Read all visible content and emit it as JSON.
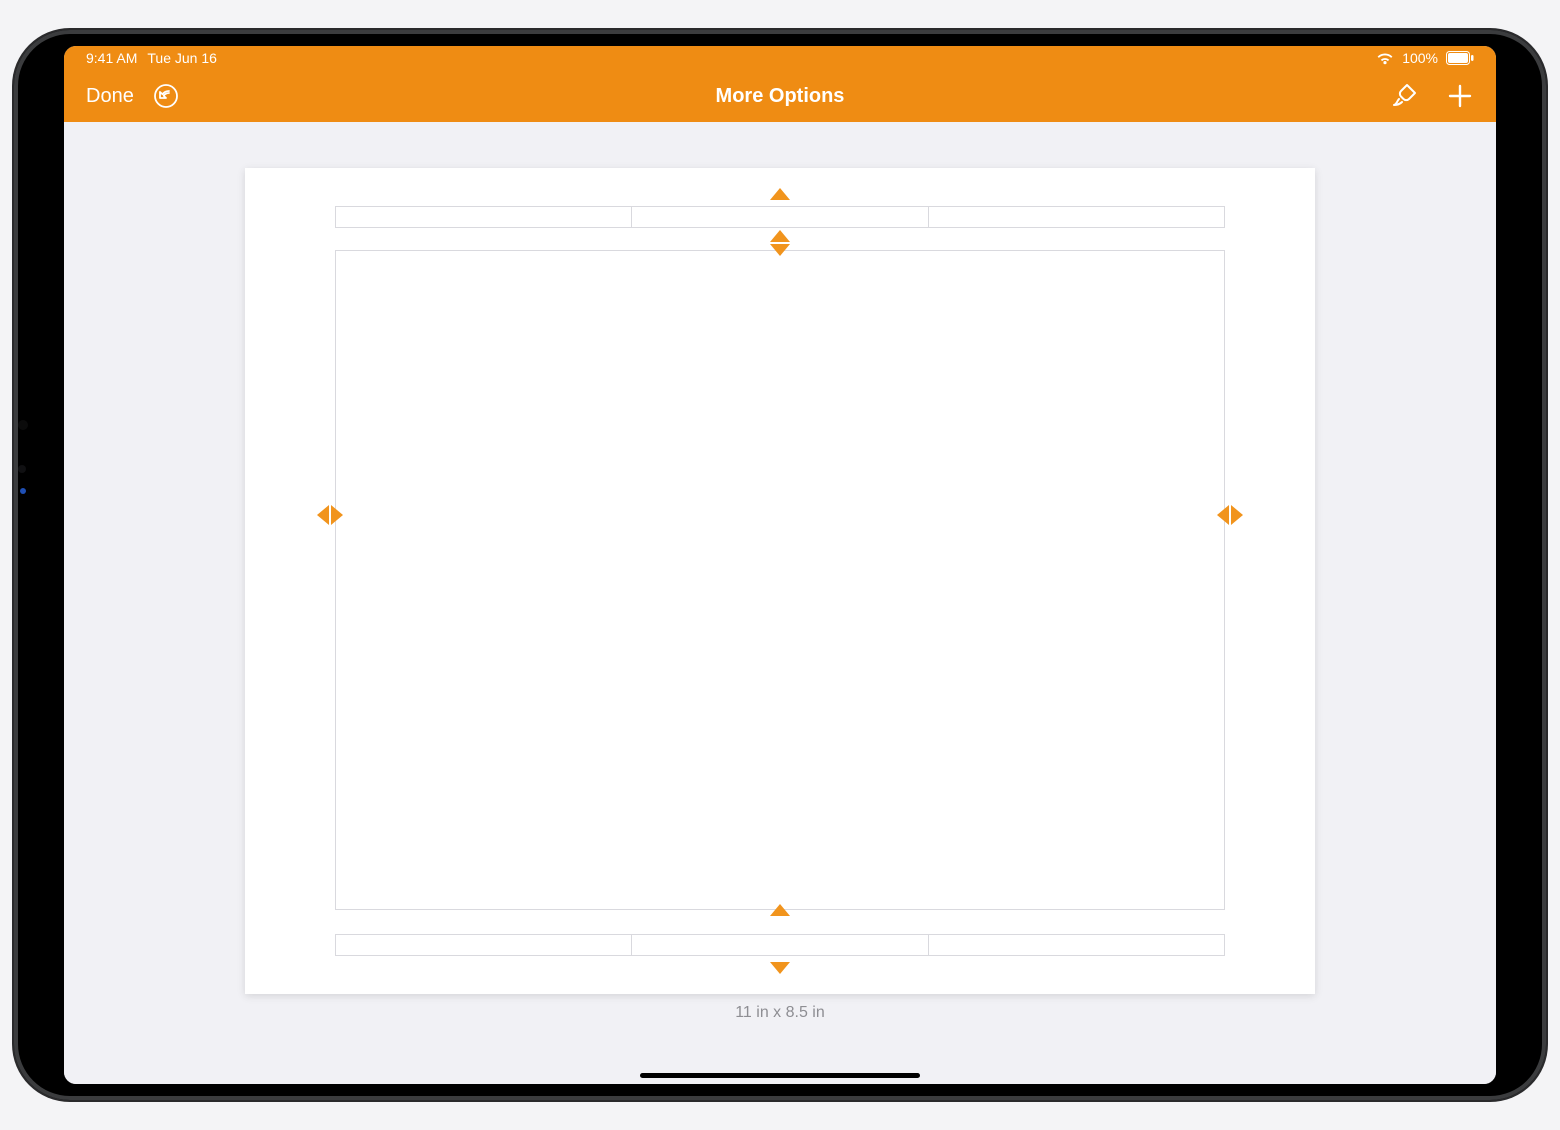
{
  "status": {
    "time": "9:41 AM",
    "date": "Tue Jun 16",
    "battery": "100%"
  },
  "toolbar": {
    "done_label": "Done",
    "title": "More Options"
  },
  "page": {
    "dimensions_label": "11 in x 8.5 in"
  },
  "colors": {
    "accent": "#ef8c13"
  }
}
